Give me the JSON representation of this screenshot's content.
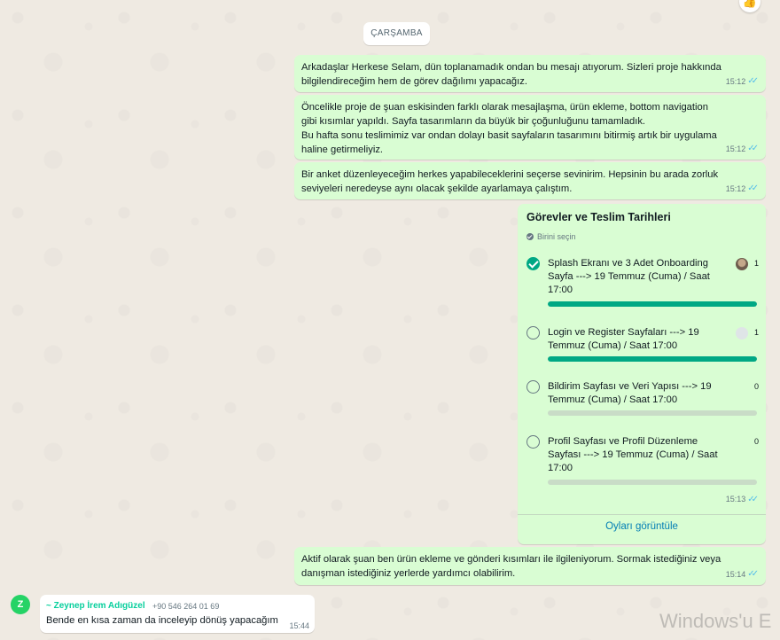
{
  "date_chip": "ÇARŞAMBA",
  "reaction_emoji": "👍",
  "messages": [
    {
      "text": "Arkadaşlar Herkese Selam, dün toplanamadık ondan bu mesajı atıyorum. Sizleri proje hakkında bilgilendireceğim hem de görev dağılımı yapacağız.",
      "time": "15:12"
    },
    {
      "text": "Öncelikle proje de şuan eskisinden farklı olarak mesajlaşma, ürün ekleme, bottom navigation gibi kısımlar yapıldı. Sayfa tasarımların da büyük bir çoğunluğunu tamamladık.\nBu hafta sonu teslimimiz var ondan dolayı basit sayfaların tasarımını bitirmiş artık bir uygulama haline getirmeliyiz.",
      "time": "15:12"
    },
    {
      "text": "Bir anket düzenleyeceğim herkes yapabileceklerini seçerse sevinirim. Hepsinin bu arada zorluk seviyeleri neredeyse aynı olacak şekilde ayarlamaya çalıştım.",
      "time": "15:12"
    },
    {
      "text": "Aktif olarak şuan ben ürün ekleme ve gönderi kısımları ile ilgileniyorum. Sormak istediğiniz veya danışman istediğiniz yerlerde yardımcı olabilirim.",
      "time": "15:14"
    }
  ],
  "poll": {
    "title": "Görevler ve Teslim Tarihleri",
    "subtitle": "Birini seçin",
    "time": "15:13",
    "view_votes": "Oyları görüntüle",
    "options": [
      {
        "label": "Splash Ekranı ve 3 Adet Onboarding Sayfa ---> 19 Temmuz (Cuma) / Saat 17:00",
        "count": "1",
        "checked": true,
        "fill": 1.0
      },
      {
        "label": "Login ve Register Sayfaları ---> 19 Temmuz (Cuma) / Saat 17:00",
        "count": "1",
        "checked": false,
        "fill": 1.0
      },
      {
        "label": "Bildirim Sayfası ve Veri Yapısı ---> 19 Temmuz (Cuma) / Saat 17:00",
        "count": "0",
        "checked": false,
        "fill": 0.0
      },
      {
        "label": "Profil Sayfası ve Profil Düzenleme Sayfası ---> 19 Temmuz (Cuma) / Saat 17:00",
        "count": "0",
        "checked": false,
        "fill": 0.0
      }
    ]
  },
  "incoming": {
    "avatar_letter": "Z",
    "sender": "~ Zeynep İrem Adıgüzel",
    "phone": "+90 546 264 01 69",
    "text": "Bende en kısa zaman da inceleyip dönüş yapacağım",
    "time": "15:44"
  },
  "watermark": "Windows'u E",
  "colors": {
    "outgoing": "#d9fdd3",
    "accent": "#00a884",
    "read_ticks": "#53bdeb",
    "sender_name": "#06cf9c",
    "link": "#027eb5"
  }
}
